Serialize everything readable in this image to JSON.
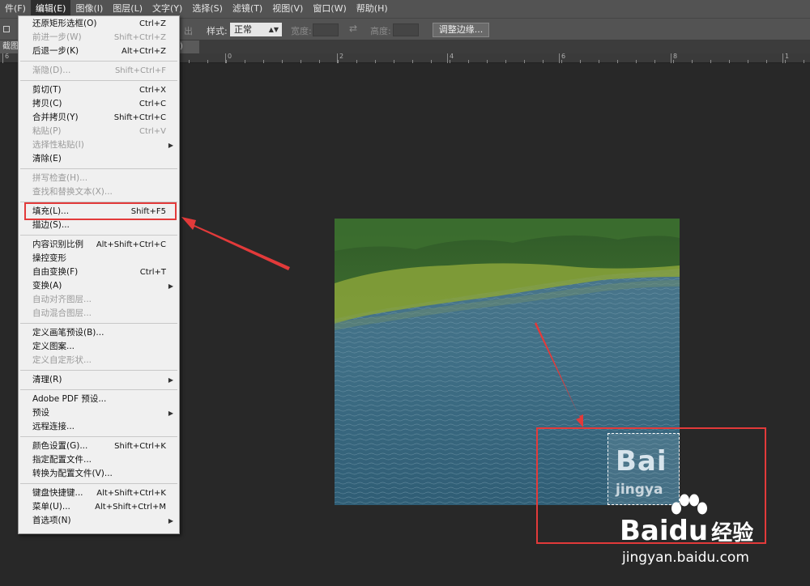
{
  "menubar": {
    "items": [
      "件(F)",
      "编辑(E)",
      "图像(I)",
      "图层(L)",
      "文字(Y)",
      "选择(S)",
      "滤镜(T)",
      "视图(V)",
      "窗口(W)",
      "帮助(H)"
    ],
    "active_index": 1
  },
  "options": {
    "partial_label": "出",
    "style_label": "样式:",
    "style_value": "正常",
    "width_label": "宽度:",
    "height_label": "高度:",
    "refine_button": "调整边缘..."
  },
  "document": {
    "tab_prefix": "截图",
    "tab_suffix": ")",
    "ruler_labels": [
      "6",
      "2",
      "0",
      "2",
      "4",
      "6",
      "8",
      "1"
    ]
  },
  "edit_menu": {
    "groups": [
      [
        {
          "label": "还原矩形选框(O)",
          "shortcut": "Ctrl+Z",
          "enabled": true
        },
        {
          "label": "前进一步(W)",
          "shortcut": "Shift+Ctrl+Z",
          "enabled": false
        },
        {
          "label": "后退一步(K)",
          "shortcut": "Alt+Ctrl+Z",
          "enabled": true
        }
      ],
      [
        {
          "label": "渐隐(D)...",
          "shortcut": "Shift+Ctrl+F",
          "enabled": false
        }
      ],
      [
        {
          "label": "剪切(T)",
          "shortcut": "Ctrl+X",
          "enabled": true
        },
        {
          "label": "拷贝(C)",
          "shortcut": "Ctrl+C",
          "enabled": true
        },
        {
          "label": "合并拷贝(Y)",
          "shortcut": "Shift+Ctrl+C",
          "enabled": true
        },
        {
          "label": "粘贴(P)",
          "shortcut": "Ctrl+V",
          "enabled": false
        },
        {
          "label": "选择性粘贴(I)",
          "shortcut": "",
          "enabled": false,
          "submenu": true
        },
        {
          "label": "清除(E)",
          "shortcut": "",
          "enabled": true
        }
      ],
      [
        {
          "label": "拼写检查(H)...",
          "shortcut": "",
          "enabled": false
        },
        {
          "label": "查找和替换文本(X)...",
          "shortcut": "",
          "enabled": false
        }
      ],
      [
        {
          "label": "填充(L)...",
          "shortcut": "Shift+F5",
          "enabled": true
        },
        {
          "label": "描边(S)...",
          "shortcut": "",
          "enabled": true
        }
      ],
      [
        {
          "label": "内容识别比例",
          "shortcut": "Alt+Shift+Ctrl+C",
          "enabled": true
        },
        {
          "label": "操控变形",
          "shortcut": "",
          "enabled": true
        },
        {
          "label": "自由变换(F)",
          "shortcut": "Ctrl+T",
          "enabled": true
        },
        {
          "label": "变换(A)",
          "shortcut": "",
          "enabled": true,
          "submenu": true
        },
        {
          "label": "自动对齐图层...",
          "shortcut": "",
          "enabled": false
        },
        {
          "label": "自动混合图层...",
          "shortcut": "",
          "enabled": false
        }
      ],
      [
        {
          "label": "定义画笔预设(B)...",
          "shortcut": "",
          "enabled": true
        },
        {
          "label": "定义图案...",
          "shortcut": "",
          "enabled": true
        },
        {
          "label": "定义自定形状...",
          "shortcut": "",
          "enabled": false
        }
      ],
      [
        {
          "label": "清理(R)",
          "shortcut": "",
          "enabled": true,
          "submenu": true
        }
      ],
      [
        {
          "label": "Adobe PDF 预设...",
          "shortcut": "",
          "enabled": true
        },
        {
          "label": "预设",
          "shortcut": "",
          "enabled": true,
          "submenu": true
        },
        {
          "label": "远程连接...",
          "shortcut": "",
          "enabled": true
        }
      ],
      [
        {
          "label": "颜色设置(G)...",
          "shortcut": "Shift+Ctrl+K",
          "enabled": true
        },
        {
          "label": "指定配置文件...",
          "shortcut": "",
          "enabled": true
        },
        {
          "label": "转换为配置文件(V)...",
          "shortcut": "",
          "enabled": true
        }
      ],
      [
        {
          "label": "键盘快捷键...",
          "shortcut": "Alt+Shift+Ctrl+K",
          "enabled": true
        },
        {
          "label": "菜单(U)...",
          "shortcut": "Alt+Shift+Ctrl+M",
          "enabled": true
        },
        {
          "label": "首选项(N)",
          "shortcut": "",
          "enabled": true,
          "submenu": true
        }
      ]
    ]
  },
  "canvas": {
    "watermark_large": "Bai",
    "watermark_small": "jingya"
  },
  "site_watermark": {
    "bai": "Bai",
    "du": "du",
    "cn": "经验",
    "url": "jingyan.baidu.com"
  },
  "colors": {
    "annotation_red": "#e23a3a",
    "menu_bg": "#f0f0f0",
    "workspace": "#282828"
  }
}
